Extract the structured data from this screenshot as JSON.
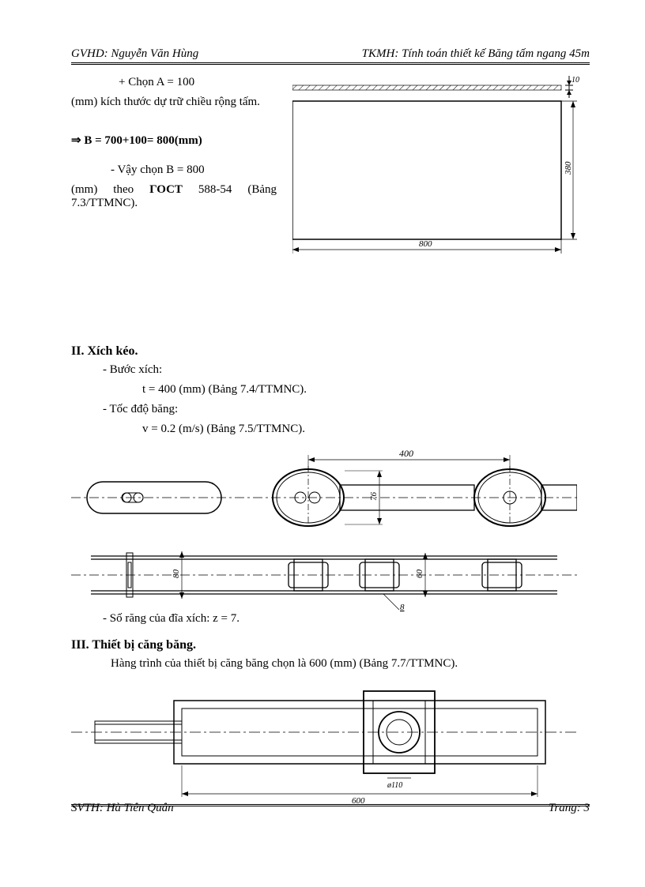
{
  "header": {
    "left": "GVHD: Nguyễn Văn Hùng",
    "right": "TKMH: Tính toán thiết kế Băng tấm ngang 45m"
  },
  "section1": {
    "p1a": "+ Chọn A = 100",
    "p1b": "(mm) kích thước dự trữ chiều rộng tấm.",
    "formula": "⇒ B = 700+100= 800(mm)",
    "p2a": "- Vậy chọn B = 800",
    "p2b": "(mm) theo ",
    "gost": "ГОСТ",
    "p2c": " 588-54 (Bảng 7.3/TTMNC).",
    "dim_top": "10",
    "dim_right": "380",
    "dim_bottom": "800"
  },
  "section2": {
    "title": "II. Xích kéo.",
    "p1": "- Bước xích:",
    "p1v": "t = 400 (mm) (Bảng 7.4/TTMNC).",
    "p2": "- Tốc đđộ băng:",
    "p2v": "v = 0.2 (m/s) (Bảng 7.5/TTMNC).",
    "dim400": "400",
    "dim76": "76",
    "dim80": "80",
    "dim60": "60",
    "dim8": "8",
    "p3": "- Số răng của đĩa xích: z = 7."
  },
  "section3": {
    "title": "III.  Thiết bị căng băng.",
    "p1": "Hàng trình của thiết bị căng băng chọn là 600 (mm) (Bảng 7.7/TTMNC).",
    "dim_phi": "ø110",
    "dim_600": "600"
  },
  "footer": {
    "left": "SVTH: Hà Tiên Quân",
    "right": "Trang: 3"
  }
}
